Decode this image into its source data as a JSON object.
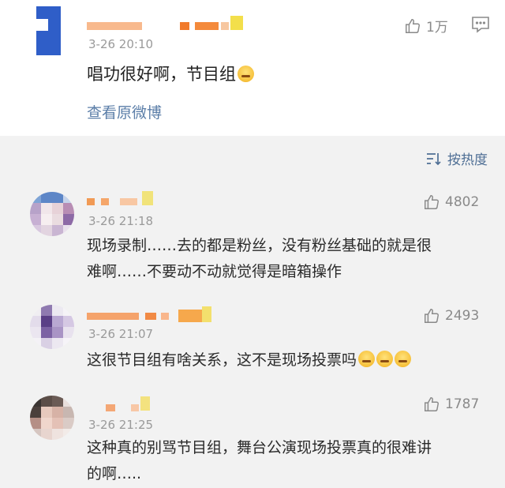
{
  "post": {
    "time": "3-26 20:10",
    "text": "唱功很好啊，节目组",
    "link": "查看原微博",
    "likes": "1万"
  },
  "sort": {
    "label": "按热度"
  },
  "comments": [
    {
      "time": "3-26 21:18",
      "likes": "4802",
      "lines": [
        "现场录制……去的都是粉丝，没有粉丝基础的就是很",
        "难啊……不要动不动就觉得是暗箱操作"
      ]
    },
    {
      "time": "3-26 21:07",
      "likes": "2493",
      "lines": [
        "这很节目组有啥关系，这不是现场投票吗"
      ]
    },
    {
      "time": "3-26 21:25",
      "likes": "1787",
      "lines": [
        "这种真的别骂节目组，舞台公演现场投票真的很难讲",
        "的啊….."
      ]
    }
  ],
  "icons": {
    "like": "thumbs-up-icon",
    "message": "message-icon",
    "sort": "sort-icon",
    "emoji": "grinning-emoji-icon"
  },
  "colors": {
    "link": "#5b7ea8",
    "sort": "#4f6f95",
    "muted": "#9a9a9a"
  }
}
